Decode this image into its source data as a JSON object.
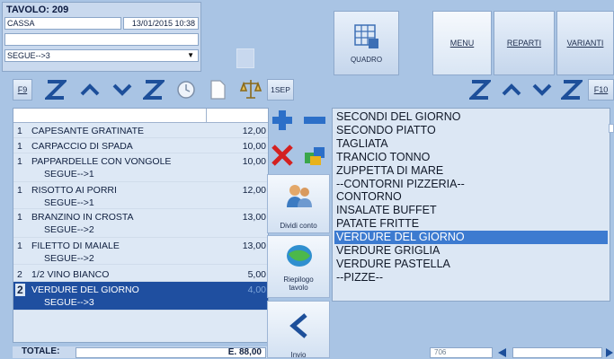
{
  "header": {
    "table": "TAVOLO: 209",
    "cassa": "CASSA",
    "datetime": "13/01/2015 10:38",
    "segue_select": "SEGUE-->3"
  },
  "toolbar": {
    "f9": "F9",
    "sep": "1SEP",
    "f10": "F10"
  },
  "order": {
    "rows": [
      {
        "qty": "1",
        "name": "CAPESANTE GRATINATE",
        "price": "12,00",
        "sub": ""
      },
      {
        "qty": "1",
        "name": "CARPACCIO DI SPADA",
        "price": "10,00",
        "sub": ""
      },
      {
        "qty": "1",
        "name": "PAPPARDELLE CON VONGOLE",
        "price": "10,00",
        "sub": "SEGUE-->1"
      },
      {
        "qty": "1",
        "name": "RISOTTO AI PORRI",
        "price": "12,00",
        "sub": "SEGUE-->1"
      },
      {
        "qty": "1",
        "name": "BRANZINO IN CROSTA",
        "price": "13,00",
        "sub": "SEGUE-->2"
      },
      {
        "qty": "1",
        "name": "FILETTO DI MAIALE",
        "price": "13,00",
        "sub": "SEGUE-->2"
      },
      {
        "qty": "2",
        "name": "1/2 VINO BIANCO",
        "price": "5,00",
        "sub": ""
      },
      {
        "qty": "2",
        "name": "VERDURE DEL GIORNO",
        "price": "4,00",
        "sub": "SEGUE-->3"
      }
    ],
    "total_label": "TOTALE:",
    "total_value": "E. 88,00"
  },
  "side_buttons": {
    "dividi": "Dividi conto",
    "riepilogo": "Riepilogo tavolo",
    "invio": "Invio"
  },
  "top_buttons": {
    "quadro": "QUADRO",
    "menu": "MENU",
    "reparti": "REPARTI",
    "varianti": "VARIANTI"
  },
  "menu_list": [
    "SECONDI DEL GIORNO",
    "SECONDO PIATTO",
    "TAGLIATA",
    "TRANCIO TONNO",
    "ZUPPETTA DI MARE",
    "--CONTORNI PIZZERIA--",
    "CONTORNO",
    "INSALATE BUFFET",
    "PATATE FRITTE",
    "VERDURE DEL GIORNO",
    "VERDURE GRIGLIA",
    "VERDURE PASTELLA",
    "--PIZZE--"
  ],
  "selected_menu_index": 9,
  "footer": {
    "code": "706"
  },
  "colors": {
    "background": "#a9c4e4",
    "selection": "#3d7bd0",
    "selected_row": "#1f4fa0"
  }
}
